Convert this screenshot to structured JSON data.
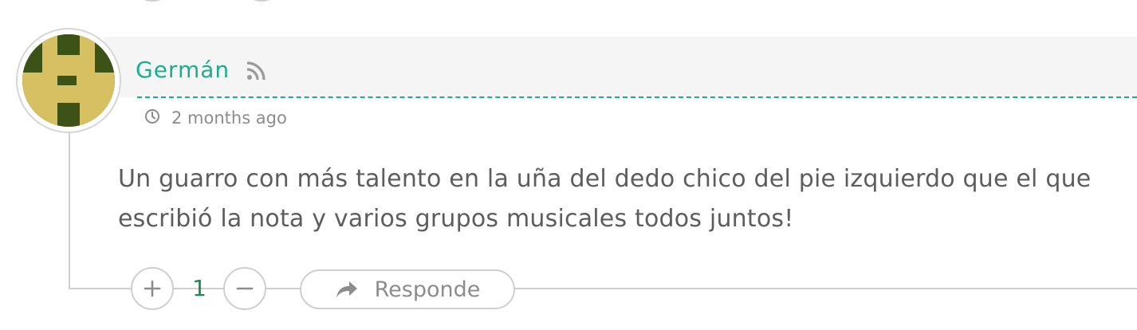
{
  "comment": {
    "author": "Germán",
    "timestamp": "2 months ago",
    "text": "Un guarro con más talento en la uña del dedo chico del pie izquierdo que el que escribió la nota y varios grupos musicales todos juntos!",
    "votes": {
      "upvote_icon": "plus-icon",
      "downvote_icon": "minus-icon",
      "score": "1"
    },
    "reply_label": "Responde",
    "icons": {
      "feed": "rss-icon",
      "time": "clock-icon",
      "reply": "reply-arrow-icon"
    }
  },
  "colors": {
    "accent": "#1aaf8a",
    "score": "#1a8a4f",
    "text": "#5d5d5d",
    "muted": "#8c8c8c",
    "avatar_dark": "#3d5216",
    "avatar_light": "#d6c062"
  }
}
